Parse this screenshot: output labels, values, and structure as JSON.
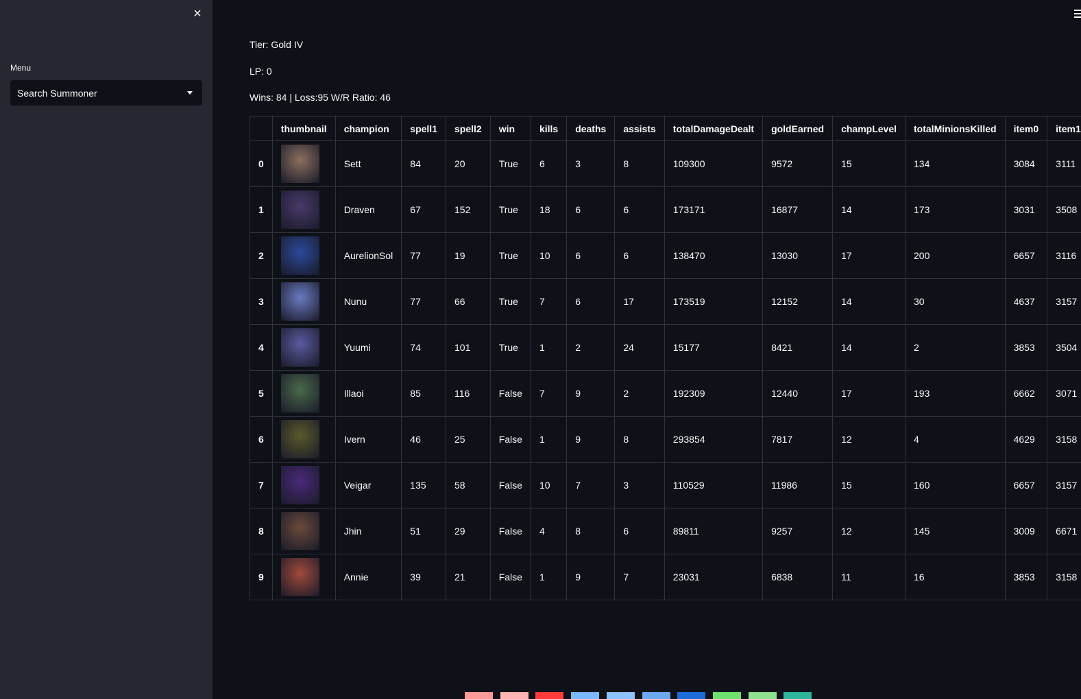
{
  "sidebar": {
    "close_icon": "×",
    "menu_label": "Menu",
    "select_value": "Search Summoner"
  },
  "info": {
    "tier": "Tier: Gold IV",
    "lp": "LP: 0",
    "record": "Wins: 84 | Loss:95 W/R Ratio: 46"
  },
  "table": {
    "columns": [
      "",
      "thumbnail",
      "champion",
      "spell1",
      "spell2",
      "win",
      "kills",
      "deaths",
      "assists",
      "totalDamageDealt",
      "goldEarned",
      "champLevel",
      "totalMinionsKilled",
      "item0",
      "item1"
    ],
    "rows": [
      {
        "idx": "0",
        "color": "#8a6f5e",
        "champion": "Sett",
        "spell1": "84",
        "spell2": "20",
        "win": "True",
        "kills": "6",
        "deaths": "3",
        "assists": "8",
        "dmg": "109300",
        "gold": "9572",
        "level": "15",
        "cs": "134",
        "item0": "3084",
        "item1": "3111"
      },
      {
        "idx": "1",
        "color": "#4a3a6a",
        "champion": "Draven",
        "spell1": "67",
        "spell2": "152",
        "win": "True",
        "kills": "18",
        "deaths": "6",
        "assists": "6",
        "dmg": "173171",
        "gold": "16877",
        "level": "14",
        "cs": "173",
        "item0": "3031",
        "item1": "3508"
      },
      {
        "idx": "2",
        "color": "#2a4a9a",
        "champion": "AurelionSol",
        "spell1": "77",
        "spell2": "19",
        "win": "True",
        "kills": "10",
        "deaths": "6",
        "assists": "6",
        "dmg": "138470",
        "gold": "13030",
        "level": "17",
        "cs": "200",
        "item0": "6657",
        "item1": "3116"
      },
      {
        "idx": "3",
        "color": "#6a7ac0",
        "champion": "Nunu",
        "spell1": "77",
        "spell2": "66",
        "win": "True",
        "kills": "7",
        "deaths": "6",
        "assists": "17",
        "dmg": "173519",
        "gold": "12152",
        "level": "14",
        "cs": "30",
        "item0": "4637",
        "item1": "3157"
      },
      {
        "idx": "4",
        "color": "#5a5aa0",
        "champion": "Yuumi",
        "spell1": "74",
        "spell2": "101",
        "win": "True",
        "kills": "1",
        "deaths": "2",
        "assists": "24",
        "dmg": "15177",
        "gold": "8421",
        "level": "14",
        "cs": "2",
        "item0": "3853",
        "item1": "3504"
      },
      {
        "idx": "5",
        "color": "#4a6a4a",
        "champion": "Illaoi",
        "spell1": "85",
        "spell2": "116",
        "win": "False",
        "kills": "7",
        "deaths": "9",
        "assists": "2",
        "dmg": "192309",
        "gold": "12440",
        "level": "17",
        "cs": "193",
        "item0": "6662",
        "item1": "3071"
      },
      {
        "idx": "6",
        "color": "#5a5a2a",
        "champion": "Ivern",
        "spell1": "46",
        "spell2": "25",
        "win": "False",
        "kills": "1",
        "deaths": "9",
        "assists": "8",
        "dmg": "293854",
        "gold": "7817",
        "level": "12",
        "cs": "4",
        "item0": "4629",
        "item1": "3158"
      },
      {
        "idx": "7",
        "color": "#4a2a7a",
        "champion": "Veigar",
        "spell1": "135",
        "spell2": "58",
        "win": "False",
        "kills": "10",
        "deaths": "7",
        "assists": "3",
        "dmg": "110529",
        "gold": "11986",
        "level": "15",
        "cs": "160",
        "item0": "6657",
        "item1": "3157"
      },
      {
        "idx": "8",
        "color": "#6a4a3a",
        "champion": "Jhin",
        "spell1": "51",
        "spell2": "29",
        "win": "False",
        "kills": "4",
        "deaths": "8",
        "assists": "6",
        "dmg": "89811",
        "gold": "9257",
        "level": "12",
        "cs": "145",
        "item0": "3009",
        "item1": "6671"
      },
      {
        "idx": "9",
        "color": "#a04a3a",
        "champion": "Annie",
        "spell1": "39",
        "spell2": "21",
        "win": "False",
        "kills": "1",
        "deaths": "9",
        "assists": "7",
        "dmg": "23031",
        "gold": "6838",
        "level": "11",
        "cs": "16",
        "item0": "3853",
        "item1": "3158"
      }
    ]
  },
  "bottom_bar_colors": [
    "#ff9a9a",
    "#ffb3b3",
    "#ff3b3b",
    "#7ab8ff",
    "#8ec2ff",
    "#6aa8f0",
    "#1c6bd8",
    "#6ee06e",
    "#8ee08e",
    "#2fb59a"
  ]
}
